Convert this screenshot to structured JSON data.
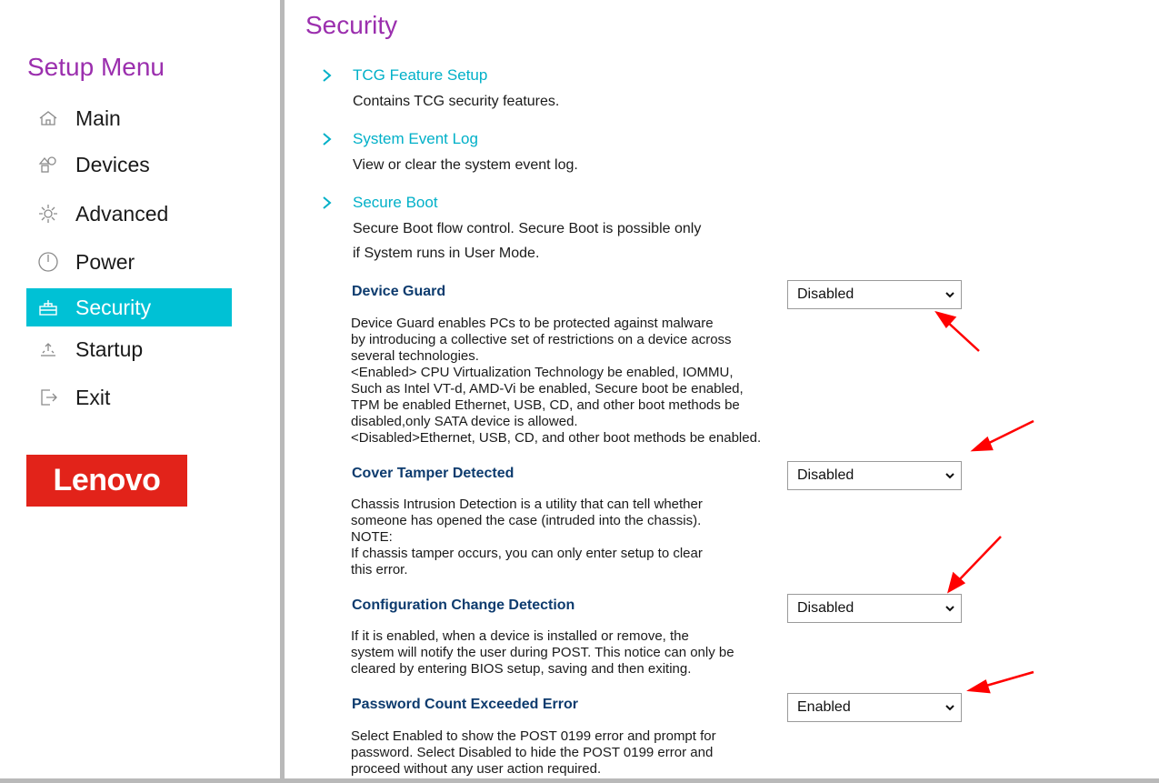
{
  "sidebar": {
    "title": "Setup Menu",
    "items": [
      {
        "label": "Main",
        "icon": "home-icon"
      },
      {
        "label": "Devices",
        "icon": "devices-icon"
      },
      {
        "label": "Advanced",
        "icon": "advanced-icon"
      },
      {
        "label": "Power",
        "icon": "power-icon"
      },
      {
        "label": "Security",
        "icon": "security-icon",
        "active": true
      },
      {
        "label": "Startup",
        "icon": "startup-icon"
      },
      {
        "label": "Exit",
        "icon": "exit-icon"
      }
    ],
    "logo_text": "Lenovo"
  },
  "main": {
    "title": "Security",
    "links": [
      {
        "title": "TCG Feature Setup",
        "desc": "Contains TCG security features."
      },
      {
        "title": "System Event Log",
        "desc": "View or clear the system event log."
      },
      {
        "title": "Secure Boot",
        "desc_lines": [
          "Secure Boot flow control. Secure Boot is possible only",
          "if System runs in User Mode."
        ]
      }
    ],
    "settings": [
      {
        "title": "Device Guard",
        "value": "Disabled",
        "desc_lines": [
          "Device Guard enables PCs to be protected against malware",
          "by introducing a collective set of restrictions on a device across",
          "several technologies.",
          "<Enabled> CPU Virtualization Technology be enabled, IOMMU,",
          "Such as Intel VT-d, AMD-Vi be enabled, Secure boot be enabled,",
          "TPM be enabled Ethernet, USB, CD, and other boot methods be",
          "disabled,only SATA device is allowed.",
          "<Disabled>Ethernet, USB, CD, and other boot methods be enabled."
        ]
      },
      {
        "title": "Cover Tamper Detected",
        "value": "Disabled",
        "desc_lines": [
          "Chassis Intrusion Detection is a utility that can tell whether",
          "someone has opened the case (intruded into the chassis).",
          "NOTE:",
          "If chassis tamper occurs, you can only enter setup to clear",
          "this error."
        ]
      },
      {
        "title": "Configuration Change Detection",
        "value": "Disabled",
        "desc_lines": [
          "If it is enabled, when a device is installed or remove, the",
          "system will notify the user during POST. This notice can only be",
          "cleared by entering BIOS setup, saving and then exiting."
        ]
      },
      {
        "title": "Password Count Exceeded Error",
        "value": "Enabled",
        "desc_lines": [
          "Select Enabled to show the POST 0199 error and prompt for",
          "password. Select Disabled to hide the POST 0199 error and",
          "proceed without any user action required."
        ]
      }
    ]
  },
  "colors": {
    "accent_purple": "#9b2fae",
    "active_cyan": "#00c1d5",
    "link_cyan": "#00b0c8",
    "setting_title_blue": "#0d3b6e",
    "lenovo_red": "#e2231a",
    "annotation_arrow_red": "#ff0000"
  }
}
